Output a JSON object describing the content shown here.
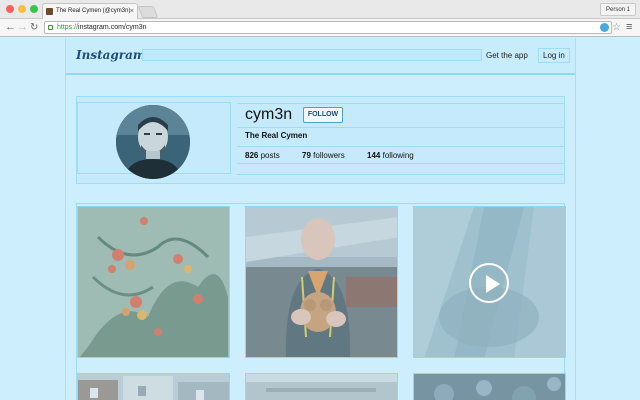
{
  "browser": {
    "tab_title": "The Real Cymen (@cym3n)",
    "tab_close": "×",
    "profile_button": "Person 1",
    "url_scheme": "https://",
    "url_rest": "instagram.com/cym3n",
    "back_icon": "←",
    "forward_icon": "→",
    "reload_icon": "↻",
    "star_icon": "☆",
    "menu_icon": "≡"
  },
  "header": {
    "logo": "Instagram",
    "get_app": "Get the app",
    "login": "Log in"
  },
  "profile": {
    "username": "cym3n",
    "follow_label": "FOLLOW",
    "full_name": "The Real Cymen",
    "posts_count": "826",
    "posts_label": "posts",
    "followers_count": "79",
    "followers_label": "followers",
    "following_count": "144",
    "following_label": "following"
  },
  "posts": [
    {
      "kind": "photo",
      "subject": "red flowers"
    },
    {
      "kind": "photo",
      "subject": "man holding puppy"
    },
    {
      "kind": "video",
      "subject": "blurred scene"
    },
    {
      "kind": "photo",
      "subject": "houses"
    },
    {
      "kind": "photo",
      "subject": "ceiling"
    },
    {
      "kind": "photo",
      "subject": "dark texture"
    }
  ],
  "colors": {
    "overlay": "#cdeefd",
    "follow_border": "#4aa0cf",
    "https_green": "#2d9e38"
  }
}
